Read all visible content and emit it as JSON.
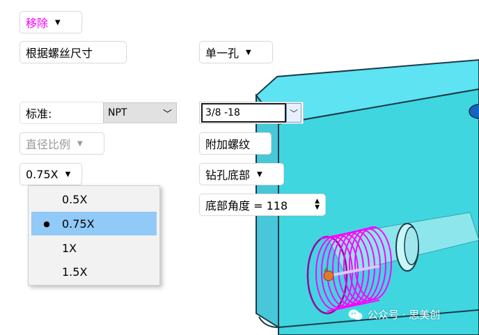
{
  "colors": {
    "accent_magenta": "#ff00ff",
    "model_cyan": "#56e0f0",
    "model_edge": "#1b3a4a",
    "selection_blue": "#91c9f7",
    "disabled_gray": "#999999"
  },
  "top": {
    "remove_label": "移除",
    "thread_size_label": "根据螺丝尺寸",
    "single_hole_label": "单一孔"
  },
  "standard": {
    "label": "标准:",
    "value": "NPT",
    "spec_value": "3/8 -18"
  },
  "options": {
    "diameter_ratio_label": "直径比例",
    "add_thread_label": "附加螺纹",
    "ratio_value": "0.75X",
    "drill_bottom_label": "钻孔底部",
    "bottom_angle_label": "底部角度 = 118"
  },
  "ratio_menu": {
    "items": [
      {
        "label": "0.5X",
        "selected": false
      },
      {
        "label": "0.75X",
        "selected": true
      },
      {
        "label": "1X",
        "selected": false
      },
      {
        "label": "1.5X",
        "selected": false
      }
    ],
    "bullet": "●"
  },
  "icons": {
    "caret": "chevron-down-icon",
    "combo_arrow": "chevron-down-icon",
    "spinner": "spinner-arrows-icon"
  },
  "watermark": {
    "text": "公众号 · 思美创"
  }
}
